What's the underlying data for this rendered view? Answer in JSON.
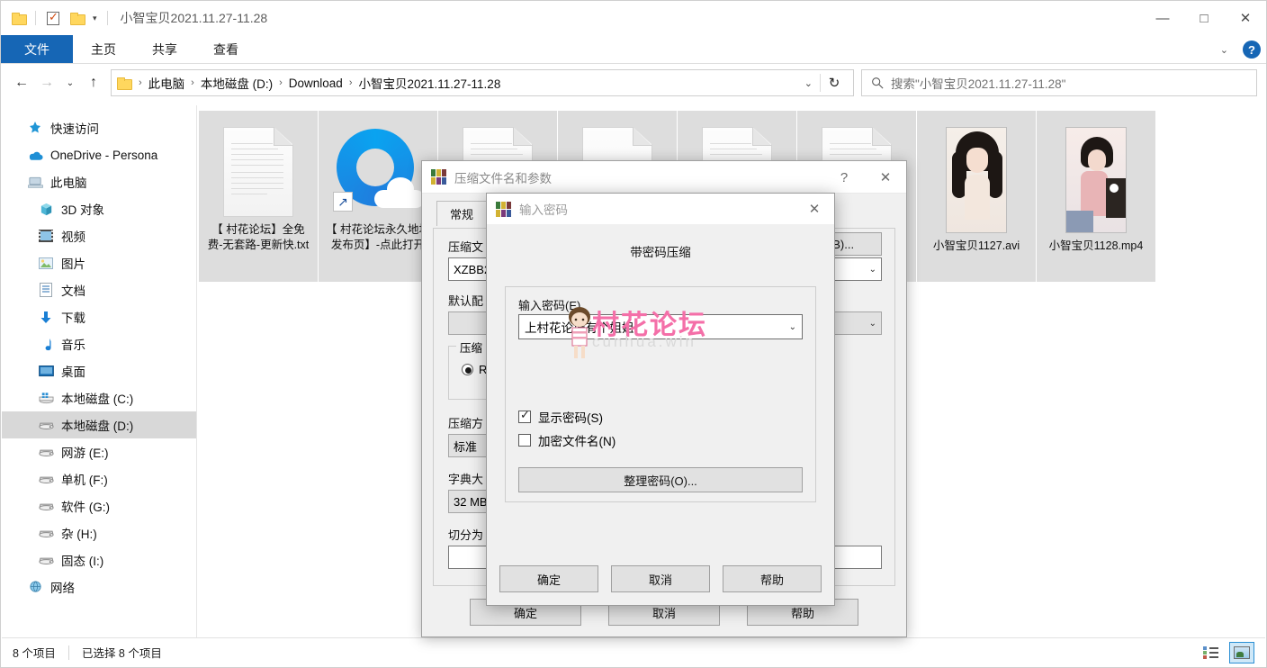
{
  "window": {
    "title": "小智宝贝2021.11.27-11.28",
    "minimize": "—",
    "maximize": "□",
    "close": "✕",
    "qat_icons": [
      "folder-icon",
      "properties-checkbox-icon",
      "new-folder-icon"
    ],
    "qat_caret": "▾"
  },
  "ribbon": {
    "tabs": [
      {
        "label": "文件",
        "active": true
      },
      {
        "label": "主页",
        "active": false
      },
      {
        "label": "共享",
        "active": false
      },
      {
        "label": "查看",
        "active": false
      }
    ],
    "collapse_caret": "⌄",
    "help_label": "?"
  },
  "addressbar": {
    "back": "←",
    "forward": "→",
    "recent": "⌄",
    "up": "↑",
    "crumbs": [
      "此电脑",
      "本地磁盘 (D:)",
      "Download",
      "小智宝贝2021.11.27-11.28"
    ],
    "separator": "›",
    "dropdown_caret": "⌄",
    "refresh": "↻"
  },
  "search": {
    "placeholder": "搜索\"小智宝贝2021.11.27-11.28\"",
    "icon": "search-icon"
  },
  "sidebar": {
    "items": [
      {
        "label": "快速访问",
        "icon": "star-pin-icon",
        "level": 0,
        "selected": false
      },
      {
        "label": "OneDrive - Persona",
        "icon": "cloud-icon",
        "level": 0,
        "selected": false
      },
      {
        "label": "此电脑",
        "icon": "pc-icon",
        "level": 0,
        "selected": false
      },
      {
        "label": "3D 对象",
        "icon": "cube-icon",
        "level": 1,
        "selected": false
      },
      {
        "label": "视频",
        "icon": "video-icon",
        "level": 1,
        "selected": false
      },
      {
        "label": "图片",
        "icon": "picture-icon",
        "level": 1,
        "selected": false
      },
      {
        "label": "文档",
        "icon": "document-icon",
        "level": 1,
        "selected": false
      },
      {
        "label": "下载",
        "icon": "download-icon",
        "level": 1,
        "selected": false
      },
      {
        "label": "音乐",
        "icon": "music-icon",
        "level": 1,
        "selected": false
      },
      {
        "label": "桌面",
        "icon": "desktop-icon",
        "level": 1,
        "selected": false
      },
      {
        "label": "本地磁盘 (C:)",
        "icon": "windows-disk-icon",
        "level": 1,
        "selected": false
      },
      {
        "label": "本地磁盘 (D:)",
        "icon": "disk-icon",
        "level": 1,
        "selected": true
      },
      {
        "label": "网游 (E:)",
        "icon": "disk-icon",
        "level": 1,
        "selected": false
      },
      {
        "label": "单机 (F:)",
        "icon": "disk-icon",
        "level": 1,
        "selected": false
      },
      {
        "label": "软件 (G:)",
        "icon": "disk-icon",
        "level": 1,
        "selected": false
      },
      {
        "label": "杂 (H:)",
        "icon": "disk-icon",
        "level": 1,
        "selected": false
      },
      {
        "label": "固态 (I:)",
        "icon": "disk-icon",
        "level": 1,
        "selected": false
      },
      {
        "label": "网络",
        "icon": "network-icon",
        "level": 0,
        "selected": false
      }
    ]
  },
  "files": [
    {
      "name": "【 村花论坛】全免费-无套路-更新快.txt",
      "icon": "text-document-icon",
      "selected": true
    },
    {
      "name": "【 村花论坛永久地址发布页】-点此打开",
      "icon": "qq-browser-shortcut-icon",
      "selected": true
    },
    {
      "name": "",
      "icon": "text-document-icon",
      "selected": true
    },
    {
      "name": "",
      "icon": "media-document-icon",
      "selected": true
    },
    {
      "name": "",
      "icon": "text-document-icon",
      "selected": true
    },
    {
      "name": "",
      "icon": "text-document-icon",
      "selected": true
    },
    {
      "name": "小智宝贝1127.avi",
      "icon": "video-thumbnail-a",
      "selected": true
    },
    {
      "name": "小智宝贝1128.mp4",
      "icon": "video-thumbnail-b",
      "selected": true
    }
  ],
  "statusbar": {
    "item_count": "8 个项目",
    "selection": "已选择 8 个项目",
    "view_details": "details-view-icon",
    "view_large_icons": "large-icons-view-icon"
  },
  "rar_dialog": {
    "title": "压缩文件名和参数",
    "icon": "winrar-icon",
    "help": "?",
    "close": "✕",
    "tabs": [
      {
        "label": "常规",
        "active": true
      }
    ],
    "archive_label": "压缩文",
    "archive_name": "XZBB2",
    "browse_button": "(B)...",
    "profile_label": "默认配",
    "format_group_label": "压缩",
    "format_rar": "RA",
    "method_label": "压缩方",
    "method_value": "标准",
    "dict_label": "字典大",
    "dict_value": "32 MB",
    "split_label": "切分为",
    "buttons": {
      "ok": "确定",
      "cancel": "取消",
      "help": "帮助"
    }
  },
  "password_dialog": {
    "title": "输入密码",
    "icon": "winrar-icon",
    "close": "✕",
    "heading": "带密码压缩",
    "password_label": "输入密码(E)",
    "password_value": "上村花论坛有个姐姐",
    "dropdown_caret": "⌄",
    "show_password_label": "显示密码(S)",
    "show_password_checked": true,
    "encrypt_filenames_label": "加密文件名(N)",
    "encrypt_filenames_checked": false,
    "organize_button": "整理密码(O)...",
    "buttons": {
      "ok": "确定",
      "cancel": "取消",
      "help": "帮助"
    }
  },
  "watermark": {
    "text": "村花论坛",
    "sub": "cunhua.win",
    "color": "#f46fa8"
  }
}
